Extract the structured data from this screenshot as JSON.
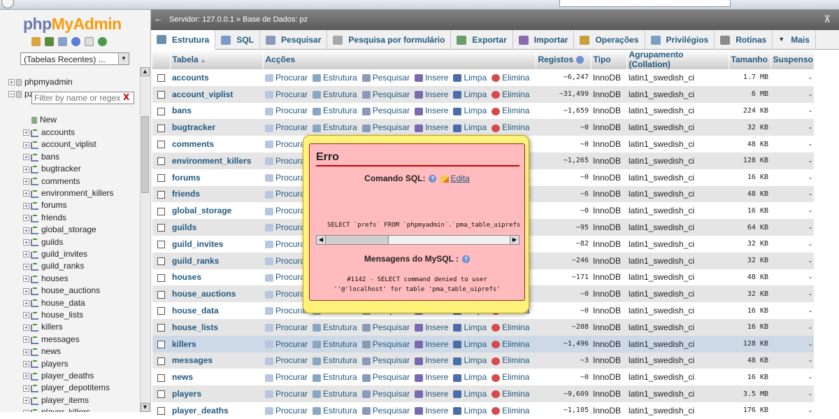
{
  "app": {
    "logo_a": "php",
    "logo_b": "MyAdmin"
  },
  "sidebar": {
    "recent_select": "(Tabelas Recentes) ...",
    "filter_placeholder": "Filter by name or regex",
    "filter_clear": "X",
    "databases": [
      "phpmyadmin",
      "pz"
    ],
    "new_label": "New",
    "tables": [
      "accounts",
      "account_viplist",
      "bans",
      "bugtracker",
      "comments",
      "environment_killers",
      "forums",
      "friends",
      "global_storage",
      "guilds",
      "guild_invites",
      "guild_ranks",
      "houses",
      "house_auctions",
      "house_data",
      "house_lists",
      "killers",
      "messages",
      "news",
      "players",
      "player_deaths",
      "player_depotitems",
      "player_items",
      "player_killers"
    ]
  },
  "breadcrumb": {
    "text": "Servidor: 127.0.0.1 » Base de Dados: pz"
  },
  "tabs": [
    {
      "label": "Estrutura",
      "icon": "structure-icon",
      "color": "#6c8fa8"
    },
    {
      "label": "SQL",
      "icon": "sql-icon",
      "color": "#7a9cc6"
    },
    {
      "label": "Pesquisar",
      "icon": "search-icon",
      "color": "#8a9ab8"
    },
    {
      "label": "Pesquisa por formulário",
      "icon": "query-icon",
      "color": "#a8a8a8"
    },
    {
      "label": "Exportar",
      "icon": "export-icon",
      "color": "#6b9e6b"
    },
    {
      "label": "Importar",
      "icon": "import-icon",
      "color": "#8a6bb0"
    },
    {
      "label": "Operações",
      "icon": "operations-icon",
      "color": "#c8a040"
    },
    {
      "label": "Privilégios",
      "icon": "privileges-icon",
      "color": "#7e9fc8"
    },
    {
      "label": "Rotinas",
      "icon": "routines-icon",
      "color": "#8a8a8a"
    },
    {
      "label": "Mais",
      "icon": "chevron-down-icon",
      "color": "#333333"
    }
  ],
  "table": {
    "headers": {
      "table": "Tabela",
      "sort": "▲",
      "actions": "Acções",
      "rows": "Registos",
      "type": "Tipo",
      "collation": "Agrupamento (Collation)",
      "size": "Tamanho",
      "overhead": "Suspenso"
    },
    "action_labels": [
      "Procurar",
      "Estrutura",
      "Pesquisar",
      "Insere",
      "Limpa",
      "Elimina"
    ],
    "rows": [
      {
        "name": "accounts",
        "rows": "~6,247",
        "type": "InnoDB",
        "collation": "latin1_swedish_ci",
        "size": "1.7 MB",
        "overhead": "-"
      },
      {
        "name": "account_viplist",
        "rows": "~31,499",
        "type": "InnoDB",
        "collation": "latin1_swedish_ci",
        "size": "6 MB",
        "overhead": "-"
      },
      {
        "name": "bans",
        "rows": "~1,659",
        "type": "InnoDB",
        "collation": "latin1_swedish_ci",
        "size": "224 KB",
        "overhead": "-"
      },
      {
        "name": "bugtracker",
        "rows": "~0",
        "type": "InnoDB",
        "collation": "latin1_swedish_ci",
        "size": "32 KB",
        "overhead": "-"
      },
      {
        "name": "comments",
        "rows": "~0",
        "type": "InnoDB",
        "collation": "latin1_swedish_ci",
        "size": "48 KB",
        "overhead": "-"
      },
      {
        "name": "environment_killers",
        "rows": "~1,265",
        "type": "InnoDB",
        "collation": "latin1_swedish_ci",
        "size": "128 KB",
        "overhead": "-"
      },
      {
        "name": "forums",
        "rows": "~0",
        "type": "InnoDB",
        "collation": "latin1_swedish_ci",
        "size": "16 KB",
        "overhead": "-"
      },
      {
        "name": "friends",
        "rows": "~6",
        "type": "InnoDB",
        "collation": "latin1_swedish_ci",
        "size": "48 KB",
        "overhead": "-"
      },
      {
        "name": "global_storage",
        "rows": "~0",
        "type": "InnoDB",
        "collation": "latin1_swedish_ci",
        "size": "16 KB",
        "overhead": "-"
      },
      {
        "name": "guilds",
        "rows": "~95",
        "type": "InnoDB",
        "collation": "latin1_swedish_ci",
        "size": "64 KB",
        "overhead": "-"
      },
      {
        "name": "guild_invites",
        "rows": "~82",
        "type": "InnoDB",
        "collation": "latin1_swedish_ci",
        "size": "32 KB",
        "overhead": "-"
      },
      {
        "name": "guild_ranks",
        "rows": "~246",
        "type": "InnoDB",
        "collation": "latin1_swedish_ci",
        "size": "32 KB",
        "overhead": "-"
      },
      {
        "name": "houses",
        "rows": "~171",
        "type": "InnoDB",
        "collation": "latin1_swedish_ci",
        "size": "48 KB",
        "overhead": "-"
      },
      {
        "name": "house_auctions",
        "rows": "~0",
        "type": "InnoDB",
        "collation": "latin1_swedish_ci",
        "size": "32 KB",
        "overhead": "-"
      },
      {
        "name": "house_data",
        "rows": "~0",
        "type": "InnoDB",
        "collation": "latin1_swedish_ci",
        "size": "16 KB",
        "overhead": "-"
      },
      {
        "name": "house_lists",
        "rows": "~208",
        "type": "InnoDB",
        "collation": "latin1_swedish_ci",
        "size": "16 KB",
        "overhead": "-"
      },
      {
        "name": "killers",
        "rows": "~1,496",
        "type": "InnoDB",
        "collation": "latin1_swedish_ci",
        "size": "128 KB",
        "overhead": "-"
      },
      {
        "name": "messages",
        "rows": "~3",
        "type": "InnoDB",
        "collation": "latin1_swedish_ci",
        "size": "48 KB",
        "overhead": "-"
      },
      {
        "name": "news",
        "rows": "~0",
        "type": "InnoDB",
        "collation": "latin1_swedish_ci",
        "size": "16 KB",
        "overhead": "-"
      },
      {
        "name": "players",
        "rows": "~9,609",
        "type": "InnoDB",
        "collation": "latin1_swedish_ci",
        "size": "3.5 MB",
        "overhead": "-"
      },
      {
        "name": "player_deaths",
        "rows": "~1,105",
        "type": "InnoDB",
        "collation": "latin1_swedish_ci",
        "size": "176 KB",
        "overhead": "-"
      }
    ]
  },
  "error_dialog": {
    "title": "Erro",
    "sql_command_label": "Comando SQL:",
    "edit_label": "Edita",
    "sql_text": "SELECT `prefs` FROM `phpmyadmin`.`pma_table_uiprefs`",
    "mysql_messages_label": "Mensagens do MySQL :",
    "message_line1": "#1142 - SELECT command denied to user",
    "message_line2": "''@'localhost' for table 'pma_table_uiprefs'"
  }
}
